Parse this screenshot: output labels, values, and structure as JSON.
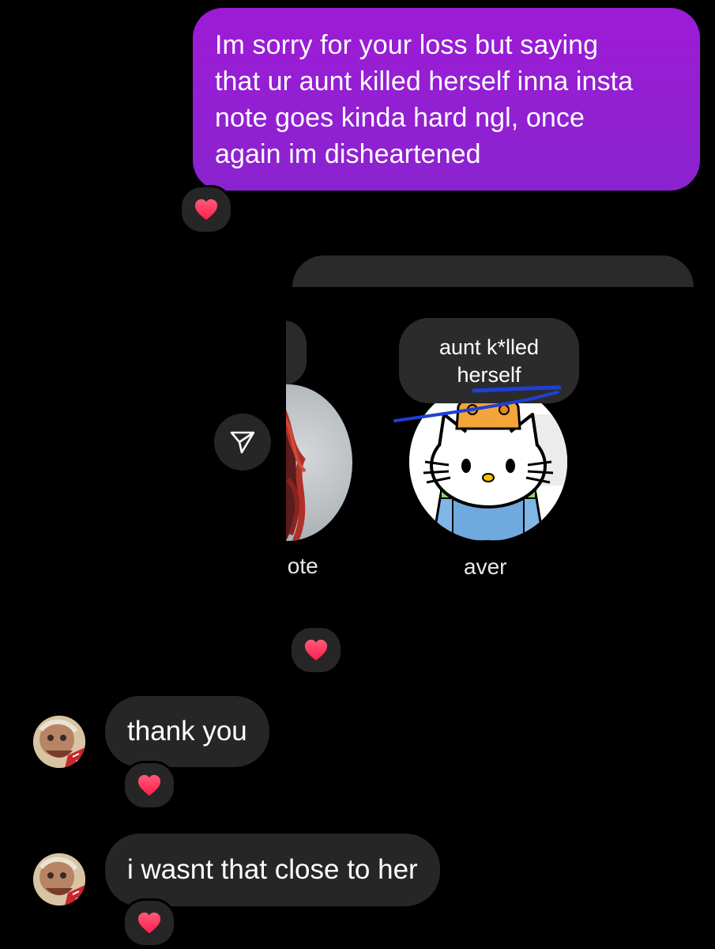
{
  "thread": {
    "sent_message": {
      "lines": [
        "Im sorry for your loss but saying",
        "that ur aunt killed herself inna insta",
        "note goes kinda hard ngl, once",
        "again im disheartened"
      ],
      "reaction": "heart"
    },
    "shared_note": {
      "left_label": "ıote",
      "right_note_lines": [
        "aunt k*lled",
        "herself"
      ],
      "right_label": "aver",
      "reaction": "heart"
    },
    "received": [
      {
        "text": "thank you",
        "reaction": "heart"
      },
      {
        "text": "i wasnt that close to her",
        "reaction": "heart"
      }
    ]
  },
  "colors": {
    "background": "#000000",
    "sent_bubble": "#8f20d3",
    "received_bubble": "#262626",
    "heart": "#ff2d55",
    "scribble": "#1f3fd6"
  },
  "icons": {
    "share": "paper-plane-icon",
    "reaction": "heart-icon"
  }
}
